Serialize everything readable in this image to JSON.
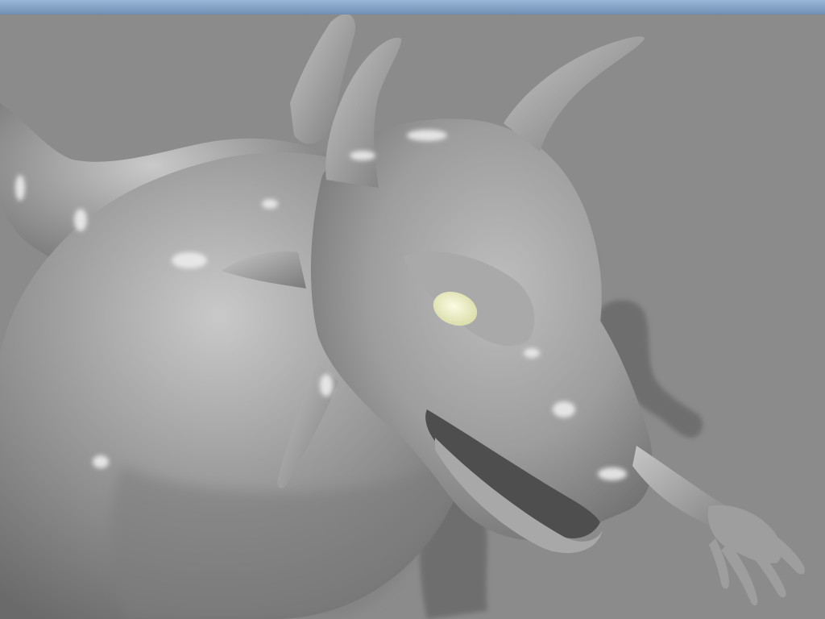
{
  "scene": {
    "background_color": "#8a8a8a",
    "floor_color": "#8d8d8d",
    "model_color": "#9c9c9c",
    "model_highlight_color": "#e6e6e6",
    "model_shadow_color": "#5e5e5e",
    "eye_color": "#eef0c6",
    "top_strip_color": "#8aa8c9"
  }
}
